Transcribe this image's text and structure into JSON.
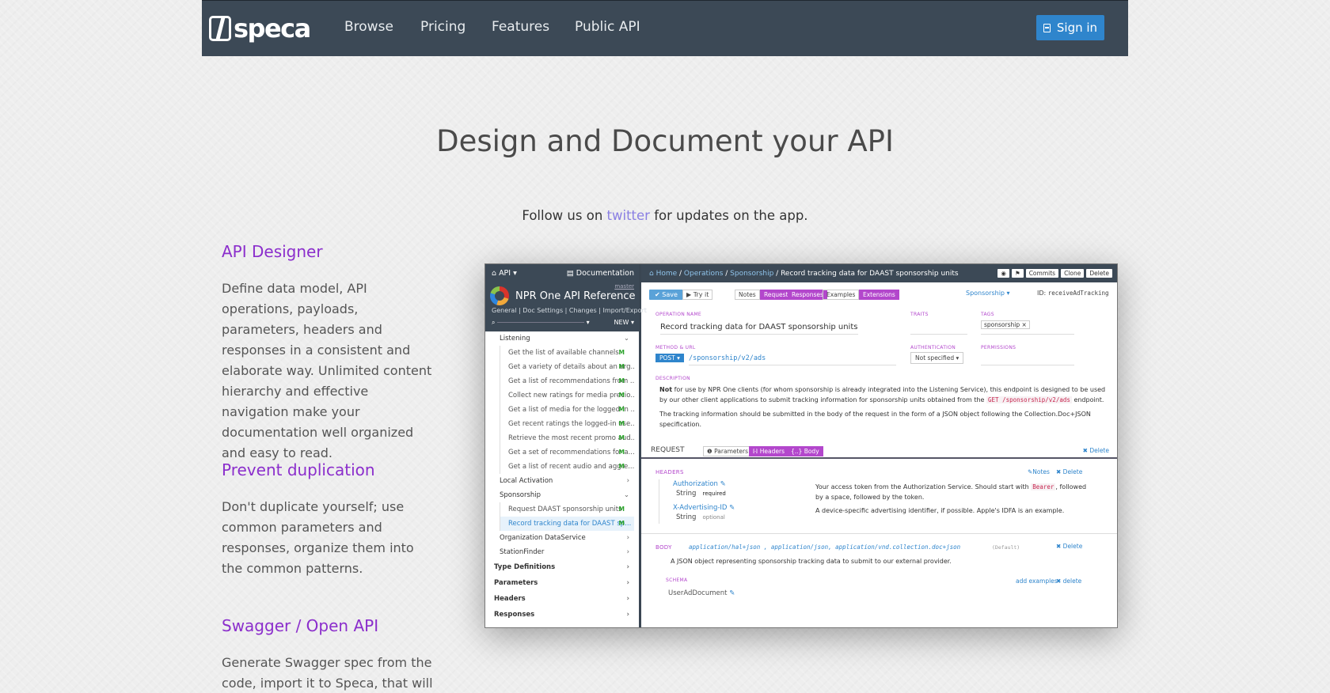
{
  "nav": {
    "logo_text": "speca",
    "links": [
      "Browse",
      "Pricing",
      "Features",
      "Public API"
    ],
    "signin_label": "Sign in"
  },
  "hero": {
    "title": "Design and Document your API",
    "follow_prefix": "Follow us on",
    "follow_link": "twitter",
    "follow_suffix": "for updates on the app."
  },
  "features": [
    {
      "title": "API Designer",
      "body": "Define data model, API operations, payloads, parameters, headers and responses in a consistent and elaborate way. Unlimited content hierarchy and effective navigation make your documentation well organized and easy to read."
    },
    {
      "title": "Prevent duplication",
      "body": "Don't duplicate yourself; use common parameters and responses, organize them into the common patterns."
    },
    {
      "title": "Swagger / Open API",
      "body": "Generate Swagger spec from the code, import it to Speca, that will be"
    }
  ],
  "app": {
    "left_header": {
      "api_menu": "API",
      "documentation": "Documentation"
    },
    "project": {
      "title": "NPR One API Reference",
      "branch": "master",
      "tabs": "General | Doc Settings | Changes | Import/Export",
      "new_label": "NEW"
    },
    "tree": [
      {
        "label": "Listening",
        "level": "l1",
        "mark": "chev-down"
      },
      {
        "label": "Get the list of available channels",
        "level": "l2",
        "mark": "M"
      },
      {
        "label": "Get a variety of details about an org...",
        "level": "l2",
        "mark": "M"
      },
      {
        "label": "Get a list of recommendations from ...",
        "level": "l2",
        "mark": "M"
      },
      {
        "label": "Collect new ratings for media previo...",
        "level": "l2",
        "mark": "M"
      },
      {
        "label": "Get a list of media for the logged-in ...",
        "level": "l2",
        "mark": "M"
      },
      {
        "label": "Get recent ratings the logged-in use...",
        "level": "l2",
        "mark": "M"
      },
      {
        "label": "Retrieve the most recent promo aud...",
        "level": "l2",
        "mark": "M"
      },
      {
        "label": "Get a set of recommendations for a...",
        "level": "l2",
        "mark": "M"
      },
      {
        "label": "Get a list of recent audio and aggre...",
        "level": "l2",
        "mark": "M"
      },
      {
        "label": "Local Activation",
        "level": "l1",
        "mark": "chev"
      },
      {
        "label": "Sponsorship",
        "level": "l1",
        "mark": "chev-down"
      },
      {
        "label": "Request DAAST sponsorship units",
        "level": "l2",
        "mark": "M"
      },
      {
        "label": "Record tracking data for DAAST sp...",
        "level": "l2",
        "mark": "M",
        "active": true
      },
      {
        "label": "Organization DataService",
        "level": "l1",
        "mark": "chev"
      },
      {
        "label": "StationFinder",
        "level": "l1",
        "mark": "chev"
      },
      {
        "label": "Type Definitions",
        "level": "l0",
        "mark": "chev"
      },
      {
        "label": "Parameters",
        "level": "l0",
        "mark": "chev"
      },
      {
        "label": "Headers",
        "level": "l0",
        "mark": "chev"
      },
      {
        "label": "Responses",
        "level": "l0",
        "mark": "chev"
      }
    ],
    "breadcrumb": {
      "home": "Home",
      "ops": "Operations",
      "group": "Sponsorship",
      "current": "Record tracking data for DAAST sponsorship units"
    },
    "tools": [
      "Commits",
      "Clone",
      "Delete"
    ],
    "toolbar": {
      "save": "Save",
      "try": "Try it",
      "tabs": [
        "Notes",
        "Request",
        "Responses",
        "Examples",
        "Extensions"
      ],
      "group_select": "Sponsorship",
      "id_label": "ID:",
      "id_value": "receiveAdTracking"
    },
    "labels": {
      "op_name": "OPERATION NAME",
      "traits": "TRAITS",
      "tags": "TAGS",
      "method": "METHOD & URL",
      "auth": "AUTHENTICATION",
      "perms": "PERMISSIONS",
      "desc": "DESCRIPTION",
      "schema": "SCHEMA"
    },
    "op_name": "Record tracking data for DAAST sponsorship units",
    "tag": "sponsorship",
    "method": "POST",
    "url": "/sponsorship/v2/ads",
    "auth": "Not specified",
    "desc1_bold": "Not",
    "desc1": "for use by NPR One clients (for whom sponsorship is already integrated into the Listening Service), this endpoint is designed to be used by our other client applications to submit tracking information for sponsorship units obtained from the",
    "desc1_code": "GET /sponsorship/v2/ads",
    "desc1_end": "endpoint.",
    "desc2": "The tracking information should be submitted in the body of the request in the form of a JSON object following the Collection.Doc+JSON specification.",
    "request": {
      "label": "REQUEST",
      "params": "Parameters",
      "headers": "Headers",
      "body": "Body",
      "delete": "Delete"
    },
    "headers_label": "HEADERS",
    "notes_link": "Notes",
    "delete_link": "Delete",
    "hdrs": [
      {
        "name": "Authorization",
        "type": "String",
        "req": "required",
        "desc_a": "Your access token from the Authorization Service. Should start with",
        "code": "Bearer",
        "desc_b": ", followed by a space, followed by the token."
      },
      {
        "name": "X-Advertising-ID",
        "type": "String",
        "req": "optional",
        "desc_a": "A device-specific advertising identifier, if possible. Apple's IDFA is an example."
      }
    ],
    "body_label": "BODY",
    "body_types": "application/hal+json ,  application/json,  application/vnd.collection.doc+json",
    "body_default": "(Default)",
    "body_desc": "A JSON object representing sponsorship tracking data to submit to our external provider.",
    "add_examples": "add examples",
    "delete_lower": "delete",
    "schema_value": "UserAdDocument"
  }
}
